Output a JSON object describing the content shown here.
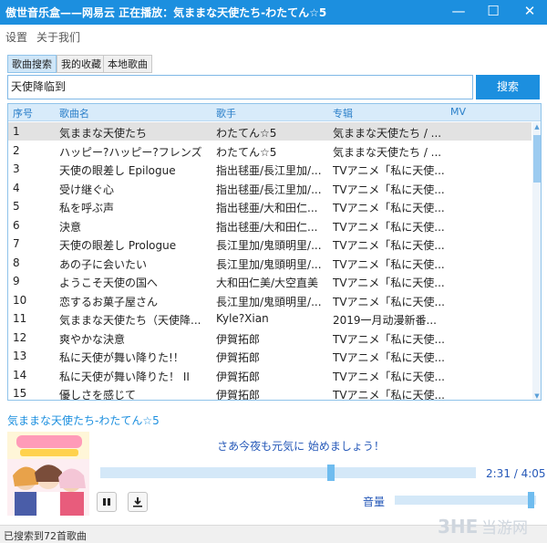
{
  "window": {
    "title": "傲世音乐盒——网易云   正在播放：気ままな天使たち-わたてん☆5",
    "minimize": "—",
    "maximize": "☐",
    "close": "✕"
  },
  "menu": [
    "设置",
    "关于我们"
  ],
  "tabs": [
    "歌曲搜索",
    "我的收藏",
    "本地歌曲"
  ],
  "search": {
    "value": "天使降临到",
    "button": "搜索"
  },
  "table": {
    "headers": [
      "序号",
      "歌曲名",
      "歌手",
      "专辑",
      "MV"
    ],
    "rows": [
      [
        "1",
        "気ままな天使たち",
        "わたてん☆5",
        "気ままな天使たち / ..."
      ],
      [
        "2",
        "ハッピー?ハッピー?フレンズ",
        "わたてん☆5",
        "気ままな天使たち / ..."
      ],
      [
        "3",
        "天使の眼差し Epilogue",
        "指出毬亜/長江里加/...",
        "TVアニメ「私に天使..."
      ],
      [
        "4",
        "受け継ぐ心",
        "指出毬亜/長江里加/...",
        "TVアニメ「私に天使..."
      ],
      [
        "5",
        "私を呼ぶ声",
        "指出毬亜/大和田仁...",
        "TVアニメ「私に天使..."
      ],
      [
        "6",
        "決意",
        "指出毬亜/大和田仁...",
        "TVアニメ「私に天使..."
      ],
      [
        "7",
        "天使の眼差し Prologue",
        "長江里加/鬼頭明里/...",
        "TVアニメ「私に天使..."
      ],
      [
        "8",
        "あの子に会いたい",
        "長江里加/鬼頭明里/...",
        "TVアニメ「私に天使..."
      ],
      [
        "9",
        "ようこそ天使の国へ",
        "大和田仁美/大空直美",
        "TVアニメ「私に天使..."
      ],
      [
        "10",
        "恋するお菓子屋さん",
        "長江里加/鬼頭明里/...",
        "TVアニメ「私に天使..."
      ],
      [
        "11",
        "気ままな天使たち（天使降...",
        "Kyle?Xian",
        "2019一月动漫新番..."
      ],
      [
        "12",
        "爽やかな決意",
        "伊賀拓郎",
        "TVアニメ「私に天使..."
      ],
      [
        "13",
        "私に天使が舞い降りた!！",
        "伊賀拓郎",
        "TVアニメ「私に天使..."
      ],
      [
        "14",
        "私に天使が舞い降りた！ II",
        "伊賀拓郎",
        "TVアニメ「私に天使..."
      ],
      [
        "15",
        "優しさを感じて",
        "伊賀拓郎",
        "TVアニメ「私に天使..."
      ]
    ]
  },
  "player": {
    "now_playing": "気ままな天使たち-わたてん☆5",
    "lyric": "さあ今夜も元気に 始めましょう！",
    "time": "2:31 / 4:05",
    "progress": 0.615,
    "volume_label": "音量",
    "volume": 0.97
  },
  "status": "已搜索到72首歌曲",
  "watermark": {
    "logo": "3HE",
    "text": "当游网"
  },
  "colors": {
    "accent": "#1c8fdf",
    "selected_row": "#e2e2e2",
    "thumb": "#6fbcef"
  },
  "icons": [
    "pause-icon",
    "download-icon",
    "minimize-icon",
    "maximize-icon",
    "close-icon"
  ]
}
